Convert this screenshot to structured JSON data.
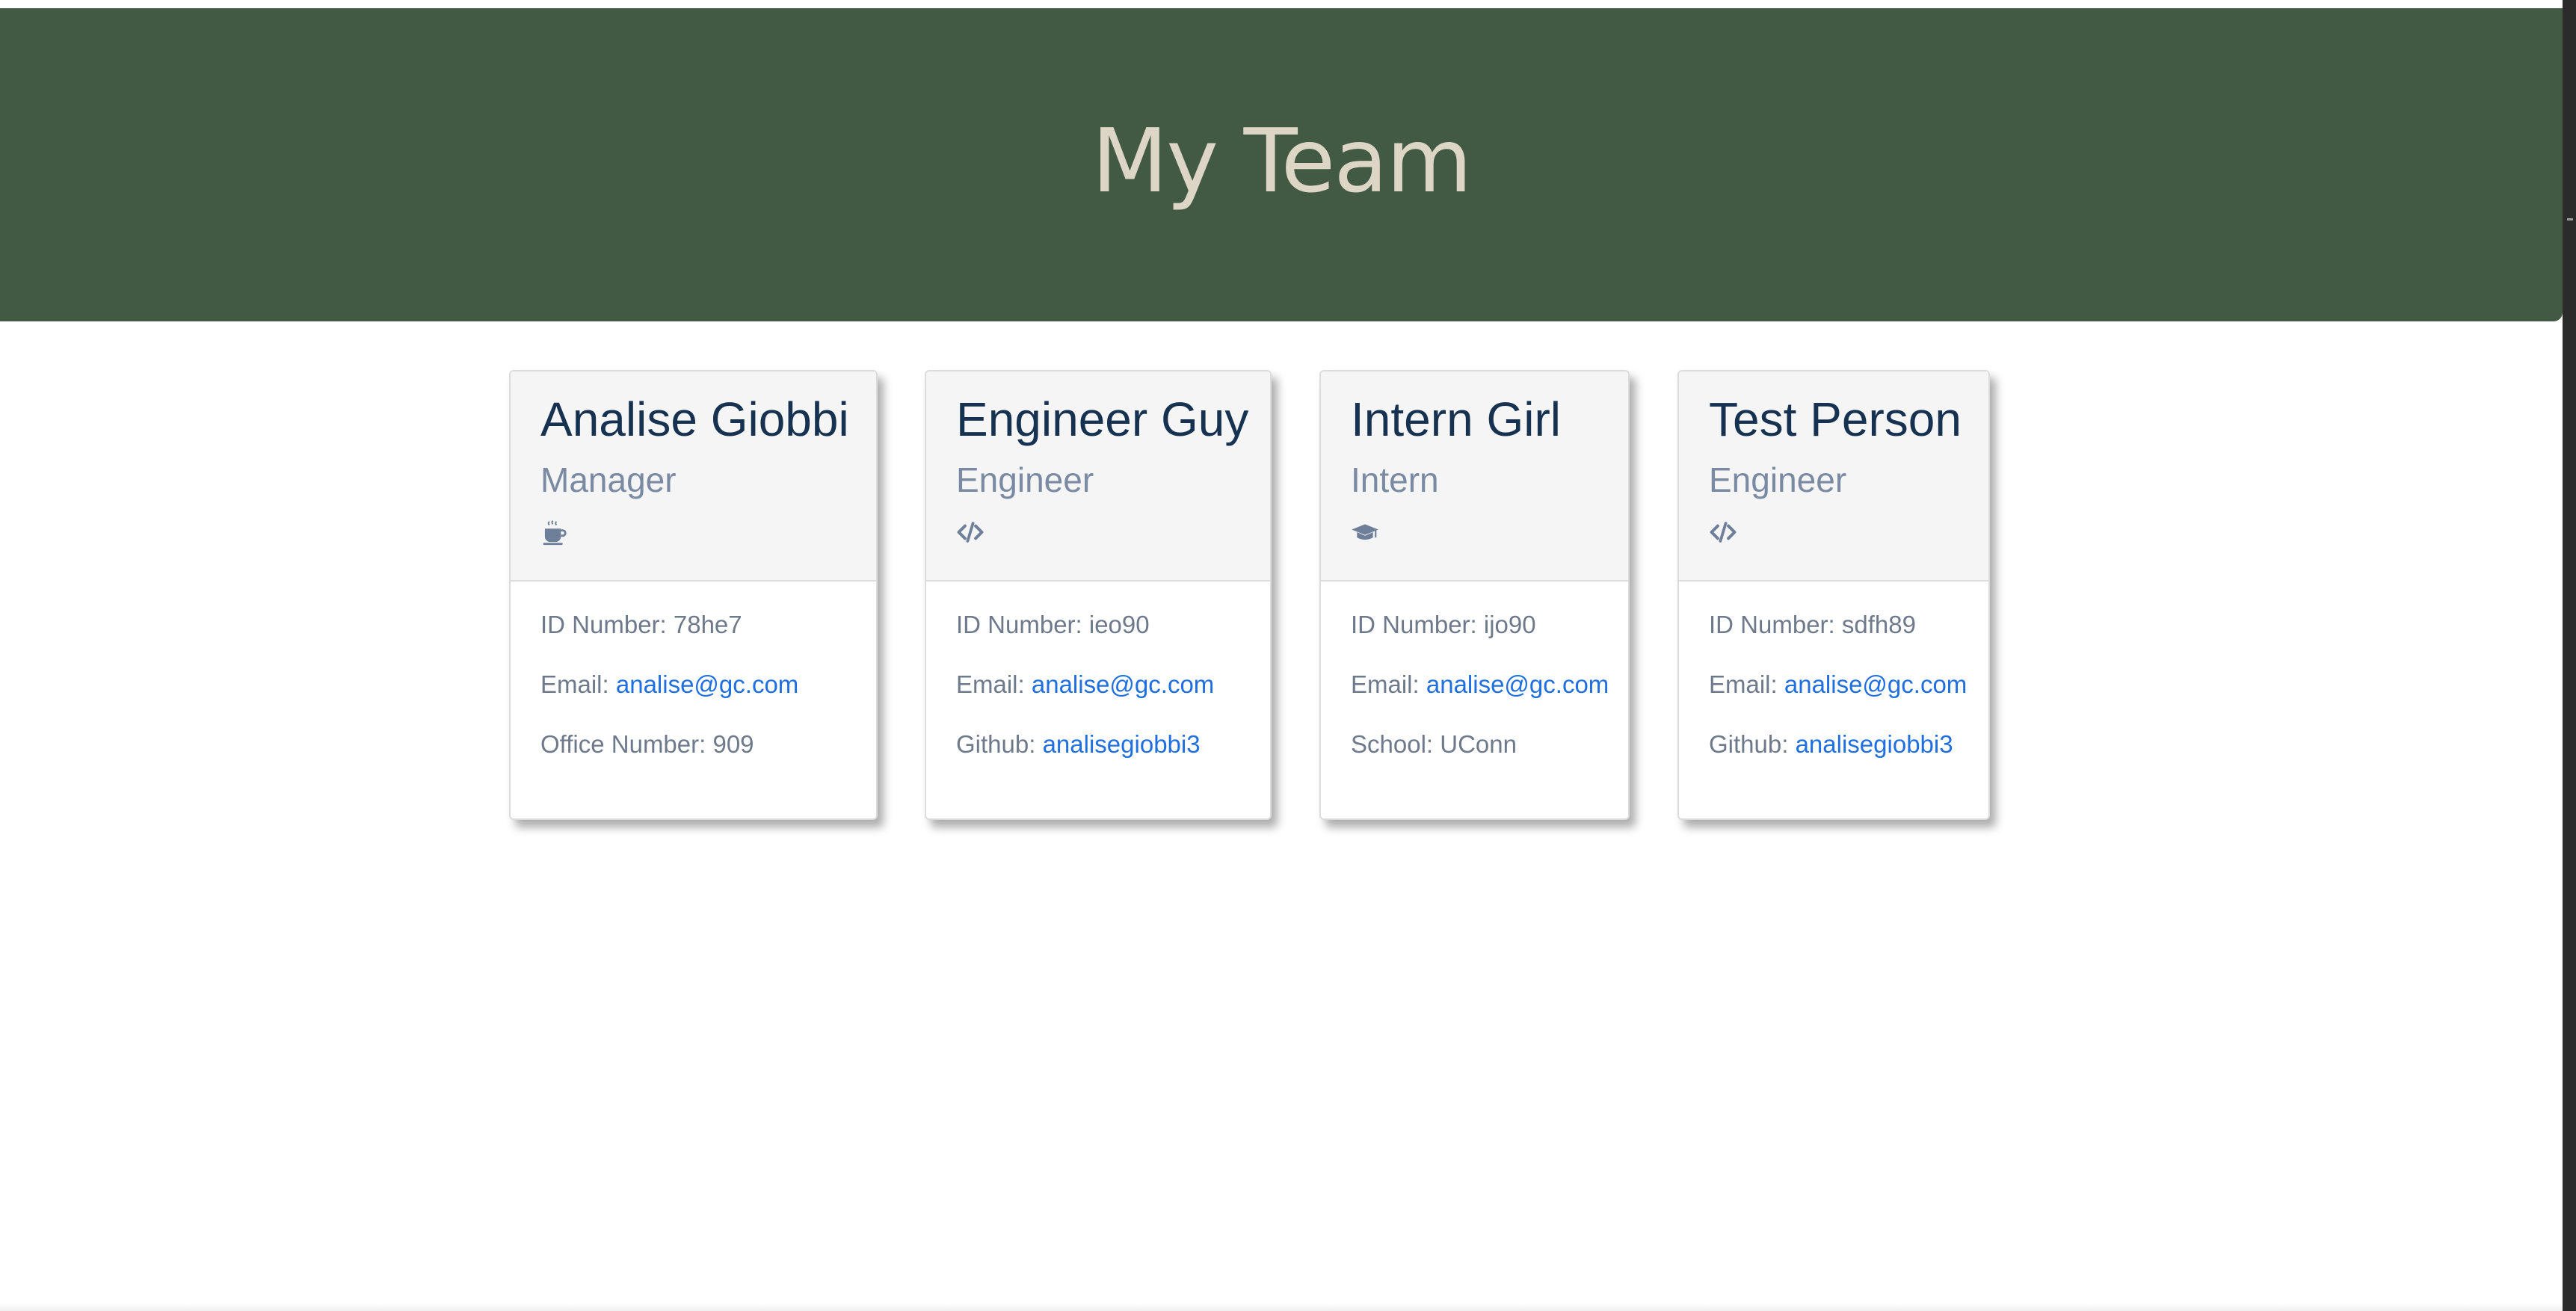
{
  "header": {
    "title": "My Team"
  },
  "team": [
    {
      "name": "Analise Giobbi",
      "role": "Manager",
      "icon": "coffee-icon",
      "id_label": "ID Number: ",
      "id_value": "78he7",
      "email_label": "Email: ",
      "email": "analise@gc.com",
      "extra_label": "Office Number: ",
      "extra_value": "909"
    },
    {
      "name": "Engineer Guy",
      "role": "Engineer",
      "icon": "code-icon",
      "id_label": "ID Number: ",
      "id_value": "ieo90",
      "email_label": "Email: ",
      "email": "analise@gc.com",
      "extra_label": "Github: ",
      "extra_value": "analisegiobbi3"
    },
    {
      "name": "Intern Girl",
      "role": "Intern",
      "icon": "graduation-cap-icon",
      "id_label": "ID Number: ",
      "id_value": "ijo90",
      "email_label": "Email: ",
      "email": "analise@gc.com",
      "extra_label": "School: ",
      "extra_value": "UConn"
    },
    {
      "name": "Test Person",
      "role": "Engineer",
      "icon": "code-icon",
      "id_label": "ID Number: ",
      "id_value": "sdfh89",
      "email_label": "Email: ",
      "email": "analise@gc.com",
      "extra_label": "Github: ",
      "extra_value": "analisegiobbi3"
    }
  ],
  "colors": {
    "header_bg": "#425944",
    "header_text": "#ddd6c6",
    "name_text": "#163250",
    "role_text": "#7a8aa3",
    "link": "#1f6fe0"
  }
}
